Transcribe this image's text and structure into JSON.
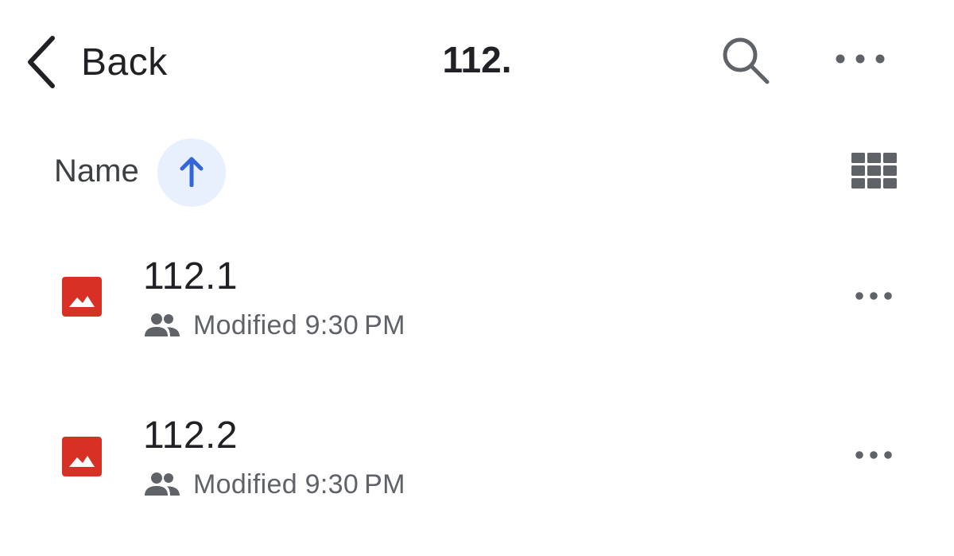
{
  "nav": {
    "back_label": "Back",
    "title": "112.",
    "search_icon": "search-icon",
    "more_icon": "more-horizontal-icon"
  },
  "sort": {
    "label": "Name",
    "direction": "ascending",
    "direction_icon": "arrow-up-icon",
    "view_toggle_icon": "grid-view-icon"
  },
  "files": [
    {
      "name": "112.1",
      "type_icon": "image-file-icon",
      "shared_icon": "people-icon",
      "modified": "Modified 9:30 PM",
      "more_icon": "more-horizontal-icon"
    },
    {
      "name": "112.2",
      "type_icon": "image-file-icon",
      "shared_icon": "people-icon",
      "modified": "Modified 9:30 PM",
      "more_icon": "more-horizontal-icon"
    }
  ],
  "colors": {
    "accent": "#3367d6",
    "accent_bg": "#e8f0fe",
    "image_file": "#d93025",
    "secondary_text": "#5f6368",
    "icon_gray": "#5f6368"
  }
}
